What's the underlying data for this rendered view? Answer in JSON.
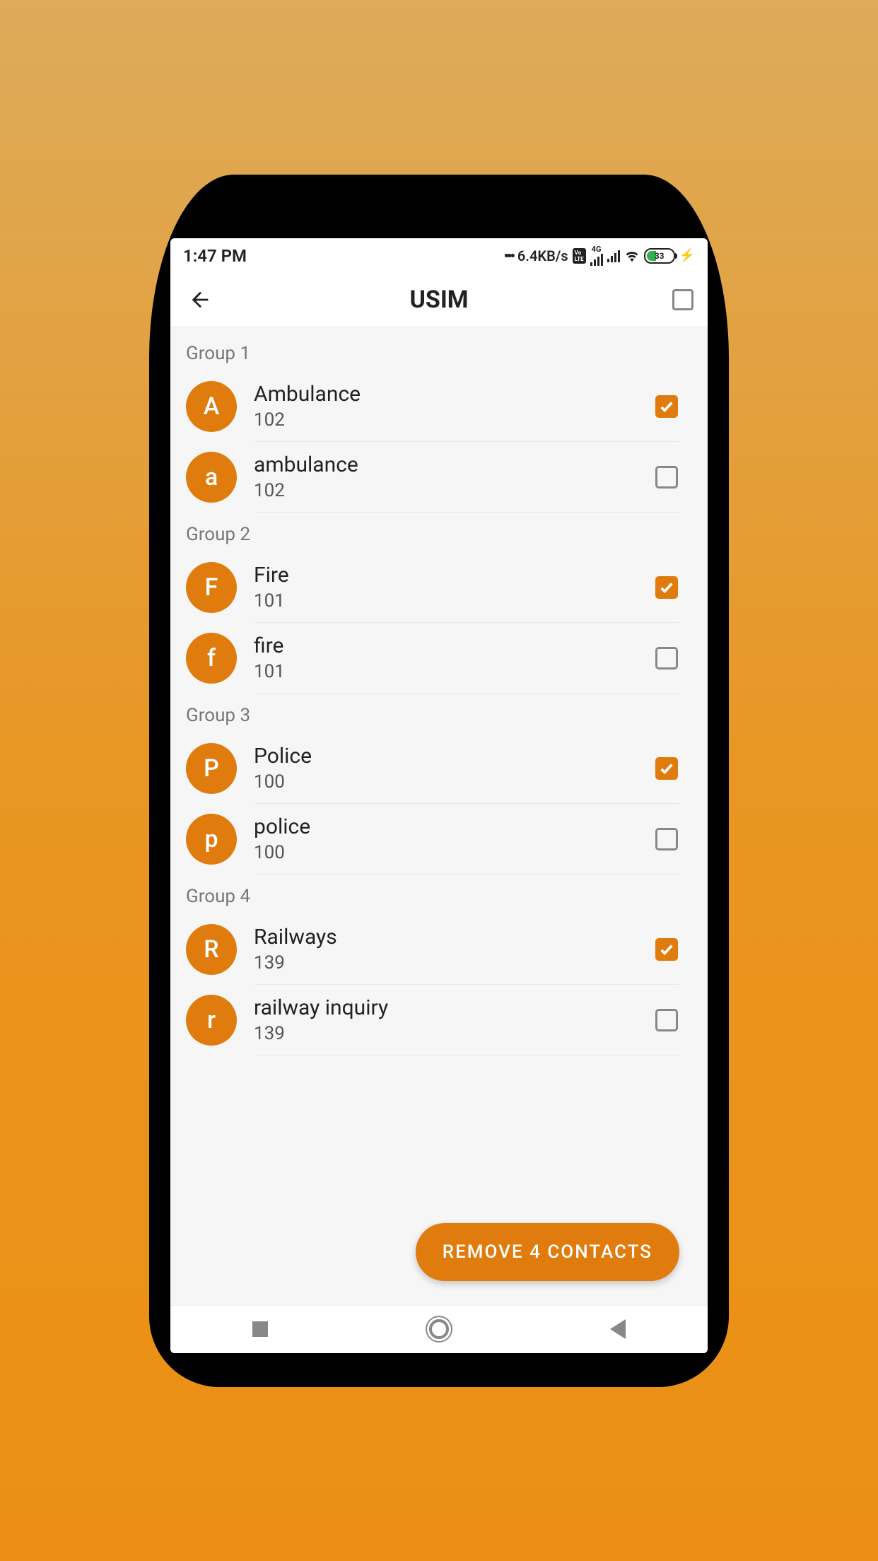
{
  "status_bar": {
    "time": "1:47 PM",
    "data_speed": "6.4KB/s",
    "volte_top": "Vo",
    "volte_bottom": "LTE",
    "network_label": "4G",
    "battery_percent": "33"
  },
  "app_bar": {
    "title": "USIM"
  },
  "groups": [
    {
      "label": "Group 1",
      "contacts": [
        {
          "avatar": "A",
          "name": "Ambulance",
          "number": "102",
          "checked": true
        },
        {
          "avatar": "a",
          "name": "ambulance",
          "number": "102",
          "checked": false
        }
      ]
    },
    {
      "label": "Group 2",
      "contacts": [
        {
          "avatar": "F",
          "name": "Fire",
          "number": "101",
          "checked": true
        },
        {
          "avatar": "f",
          "name": "fire",
          "number": "101",
          "checked": false
        }
      ]
    },
    {
      "label": "Group 3",
      "contacts": [
        {
          "avatar": "P",
          "name": "Police",
          "number": "100",
          "checked": true
        },
        {
          "avatar": "p",
          "name": "police",
          "number": "100",
          "checked": false
        }
      ]
    },
    {
      "label": "Group 4",
      "contacts": [
        {
          "avatar": "R",
          "name": "Railways",
          "number": "139",
          "checked": true
        },
        {
          "avatar": "r",
          "name": "railway inquiry",
          "number": "139",
          "checked": false
        }
      ]
    }
  ],
  "fab_label": "REMOVE 4 CONTACTS",
  "colors": {
    "accent": "#e07b0e"
  }
}
